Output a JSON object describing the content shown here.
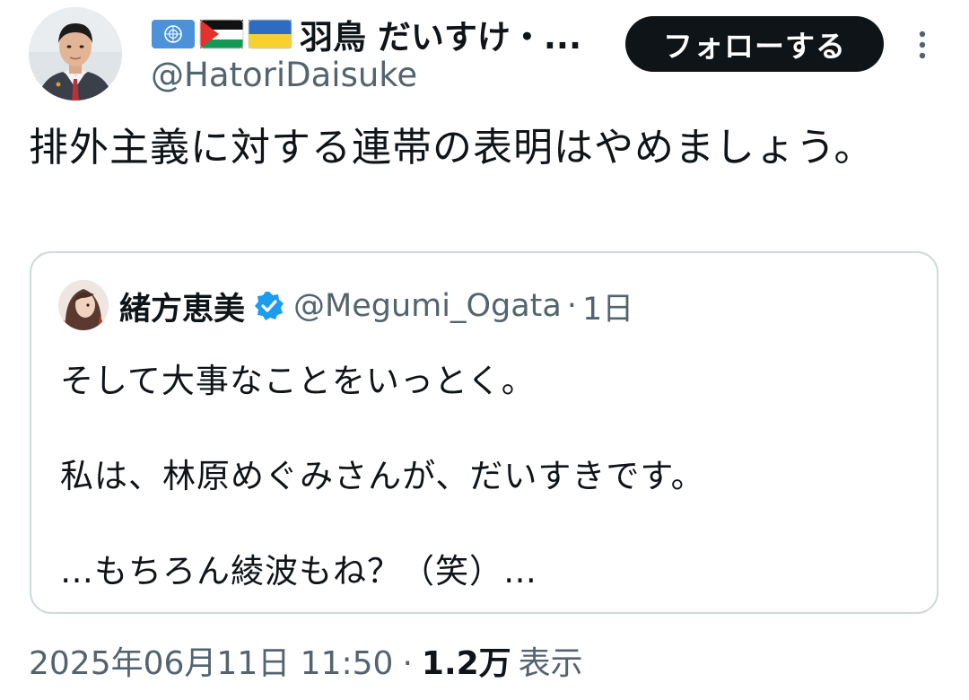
{
  "author": {
    "display_name": "羽鳥 だいすけ・...",
    "handle": "@HatoriDaisuke",
    "flags": [
      "un-flag-icon",
      "palestine-flag-icon",
      "ukraine-flag-icon"
    ]
  },
  "actions": {
    "follow_label": "フォローする"
  },
  "tweet": {
    "text": "排外主義に対する連帯の表明はやめましょう。"
  },
  "quote": {
    "name": "緒方恵美",
    "handle": "@Megumi_Ogata",
    "separator": "·",
    "time": "1日",
    "lines": [
      "そして大事なことをいっとく。",
      "私は、林原めぐみさんが、だいすきです。",
      "…もちろん綾波もね？（笑）…"
    ]
  },
  "meta": {
    "timestamp": "2025年06月11日 11:50",
    "separator": "·",
    "views_count": "1.2万",
    "views_label": "表示"
  },
  "colors": {
    "text": "#0f1419",
    "secondary": "#536471",
    "verified": "#1d9bf0",
    "button_bg": "#0f1419",
    "border": "#cfd9de"
  }
}
